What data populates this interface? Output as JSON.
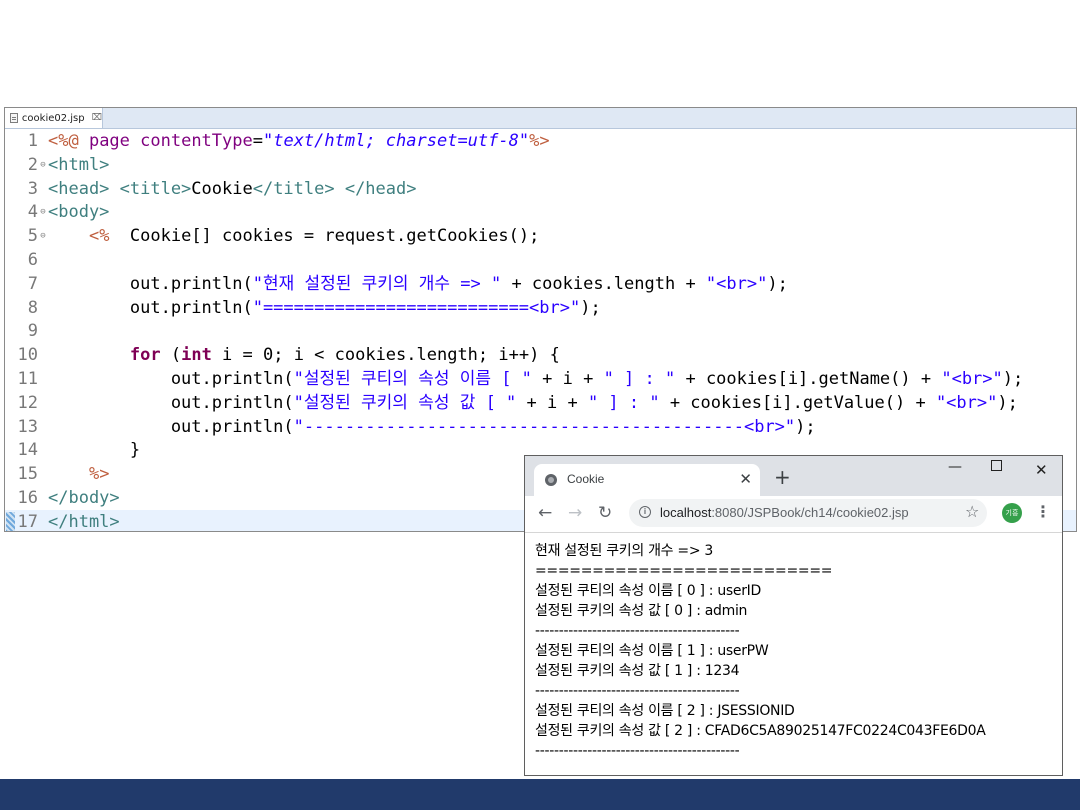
{
  "editor": {
    "tab_label": "cookie02.jsp",
    "tab_close": "⌧",
    "lines": [
      {
        "n": "1",
        "fold": "",
        "segs": [
          [
            "dir",
            "<%@ "
          ],
          [
            "attr",
            "page "
          ],
          [
            "attr",
            "contentType"
          ],
          [
            "pl",
            "="
          ],
          [
            "ital",
            "\"text/html; charset=utf-8\""
          ],
          [
            "dir",
            "%>"
          ]
        ]
      },
      {
        "n": "2",
        "fold": "⊖",
        "segs": [
          [
            "tg",
            "<html>"
          ]
        ]
      },
      {
        "n": "3",
        "fold": "",
        "segs": [
          [
            "tg",
            "<head> <title>"
          ],
          [
            "pl",
            "Cookie"
          ],
          [
            "tg",
            "</title> </head>"
          ]
        ]
      },
      {
        "n": "4",
        "fold": "⊖",
        "segs": [
          [
            "tg",
            "<body>"
          ]
        ]
      },
      {
        "n": "5",
        "fold": "⊖",
        "segs": [
          [
            "pl",
            "    "
          ],
          [
            "dir",
            "<%"
          ],
          [
            "pl",
            "  Cookie[] cookies = request.getCookies();"
          ]
        ]
      },
      {
        "n": "6",
        "fold": "",
        "segs": [
          [
            "pl",
            ""
          ]
        ]
      },
      {
        "n": "7",
        "fold": "",
        "segs": [
          [
            "pl",
            "        out.println("
          ],
          [
            "str",
            "\"현재 설정된 쿠키의 개수 => \""
          ],
          [
            "pl",
            " + cookies.length + "
          ],
          [
            "str",
            "\"<br>\""
          ],
          [
            "pl",
            ");"
          ]
        ]
      },
      {
        "n": "8",
        "fold": "",
        "segs": [
          [
            "pl",
            "        out.println("
          ],
          [
            "str",
            "\"==========================<br>\""
          ],
          [
            "pl",
            ");"
          ]
        ]
      },
      {
        "n": "9",
        "fold": "",
        "segs": [
          [
            "pl",
            ""
          ]
        ]
      },
      {
        "n": "10",
        "fold": "",
        "segs": [
          [
            "pl",
            "        "
          ],
          [
            "kw",
            "for"
          ],
          [
            "pl",
            " ("
          ],
          [
            "kw",
            "int"
          ],
          [
            "pl",
            " i = 0; i < cookies.length; i++) {"
          ]
        ]
      },
      {
        "n": "11",
        "fold": "",
        "segs": [
          [
            "pl",
            "            out.println("
          ],
          [
            "str",
            "\"설정된 쿠티의 속성 이름 [ \""
          ],
          [
            "pl",
            " + i + "
          ],
          [
            "str",
            "\" ] : \""
          ],
          [
            "pl",
            " + cookies[i].getName() + "
          ],
          [
            "str",
            "\"<br>\""
          ],
          [
            "pl",
            ");"
          ]
        ]
      },
      {
        "n": "12",
        "fold": "",
        "segs": [
          [
            "pl",
            "            out.println("
          ],
          [
            "str",
            "\"설정된 쿠키의 속성 값 [ \""
          ],
          [
            "pl",
            " + i + "
          ],
          [
            "str",
            "\" ] : \""
          ],
          [
            "pl",
            " + cookies[i].getValue() + "
          ],
          [
            "str",
            "\"<br>\""
          ],
          [
            "pl",
            ");"
          ]
        ]
      },
      {
        "n": "13",
        "fold": "",
        "segs": [
          [
            "pl",
            "            out.println("
          ],
          [
            "str",
            "\"-------------------------------------------<br>\""
          ],
          [
            "pl",
            ");"
          ]
        ]
      },
      {
        "n": "14",
        "fold": "",
        "segs": [
          [
            "pl",
            "        }"
          ]
        ]
      },
      {
        "n": "15",
        "fold": "",
        "segs": [
          [
            "pl",
            "    "
          ],
          [
            "dir",
            "%>"
          ]
        ]
      },
      {
        "n": "16",
        "fold": "",
        "segs": [
          [
            "tg",
            "</body>"
          ]
        ]
      },
      {
        "n": "17",
        "fold": "",
        "segs": [
          [
            "tg",
            "</html>"
          ]
        ]
      }
    ]
  },
  "browser": {
    "tab_title": "Cookie",
    "tab_close": "✕",
    "new_tab": "+",
    "minimize": "—",
    "close": "✕",
    "back": "←",
    "forward": "→",
    "reload": "↻",
    "info": "i",
    "url_host": "localhost",
    "url_rest": ":8080/JSPBook/ch14/cookie02.jsp",
    "star": "☆",
    "avatar": "기흥",
    "menu": "⋮",
    "content_lines": [
      "현재 설정된 쿠키의 개수 => 3",
      "==========================",
      "설정된 쿠티의 속성 이름 [ 0 ] : userID",
      "설정된 쿠키의 속성 값 [ 0 ] : admin",
      "-------------------------------------------",
      "설정된 쿠티의 속성 이름 [ 1 ] : userPW",
      "설정된 쿠키의 속성 값 [ 1 ] : 1234",
      "-------------------------------------------",
      "설정된 쿠티의 속성 이름 [ 2 ] : JSESSIONID",
      "설정된 쿠키의 속성 값 [ 2 ] : CFAD6C5A89025147FC0224C043FE6D0A",
      "-------------------------------------------"
    ]
  }
}
